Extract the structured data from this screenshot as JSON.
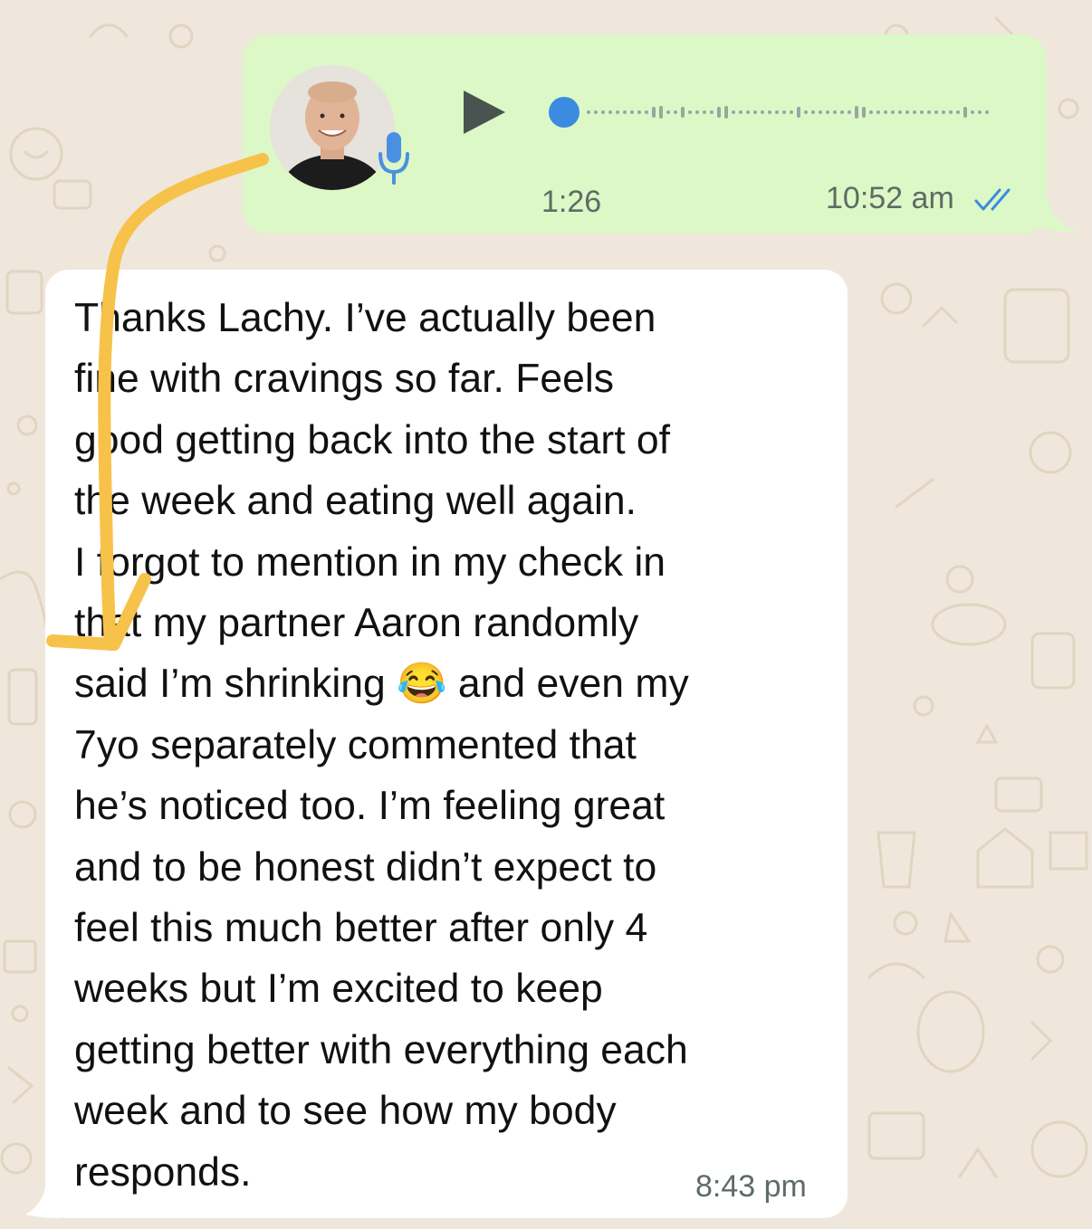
{
  "voice_message": {
    "duration": "1:26",
    "time": "10:52 am",
    "icons": {
      "avatar": "avatar-photo",
      "mic": "mic-icon",
      "play": "play-icon",
      "read_receipt": "double-check-icon"
    },
    "colors": {
      "bubble": "#dcf8c6",
      "mic": "#4a90e2",
      "progress_dot": "#3b8be0",
      "read_receipt": "#3b8be0"
    }
  },
  "text_message": {
    "lines": [
      "Thanks Lachy. I’ve actually been",
      "fine with cravings so far. Feels",
      "good getting back into the start of",
      "the week and eating well again.",
      "I forgot to mention in my check in",
      "that my partner Aaron randomly",
      "said I’m shrinking 😂 and even my",
      "7yo separately commented that",
      "he’s noticed too. I’m feeling great",
      "and to be honest didn’t expect to",
      "feel this much better after only 4",
      "weeks but I’m excited to keep",
      "getting better with everything each",
      "week and to see how my body",
      "responds."
    ],
    "time": "8:43 pm",
    "colors": {
      "bubble": "#ffffff"
    }
  },
  "annotation": {
    "icon": "hand-drawn-arrow",
    "color": "#f7c24a"
  },
  "wallpaper": {
    "color": "#efe7dc",
    "doodle_color": "#e2d7c6"
  }
}
